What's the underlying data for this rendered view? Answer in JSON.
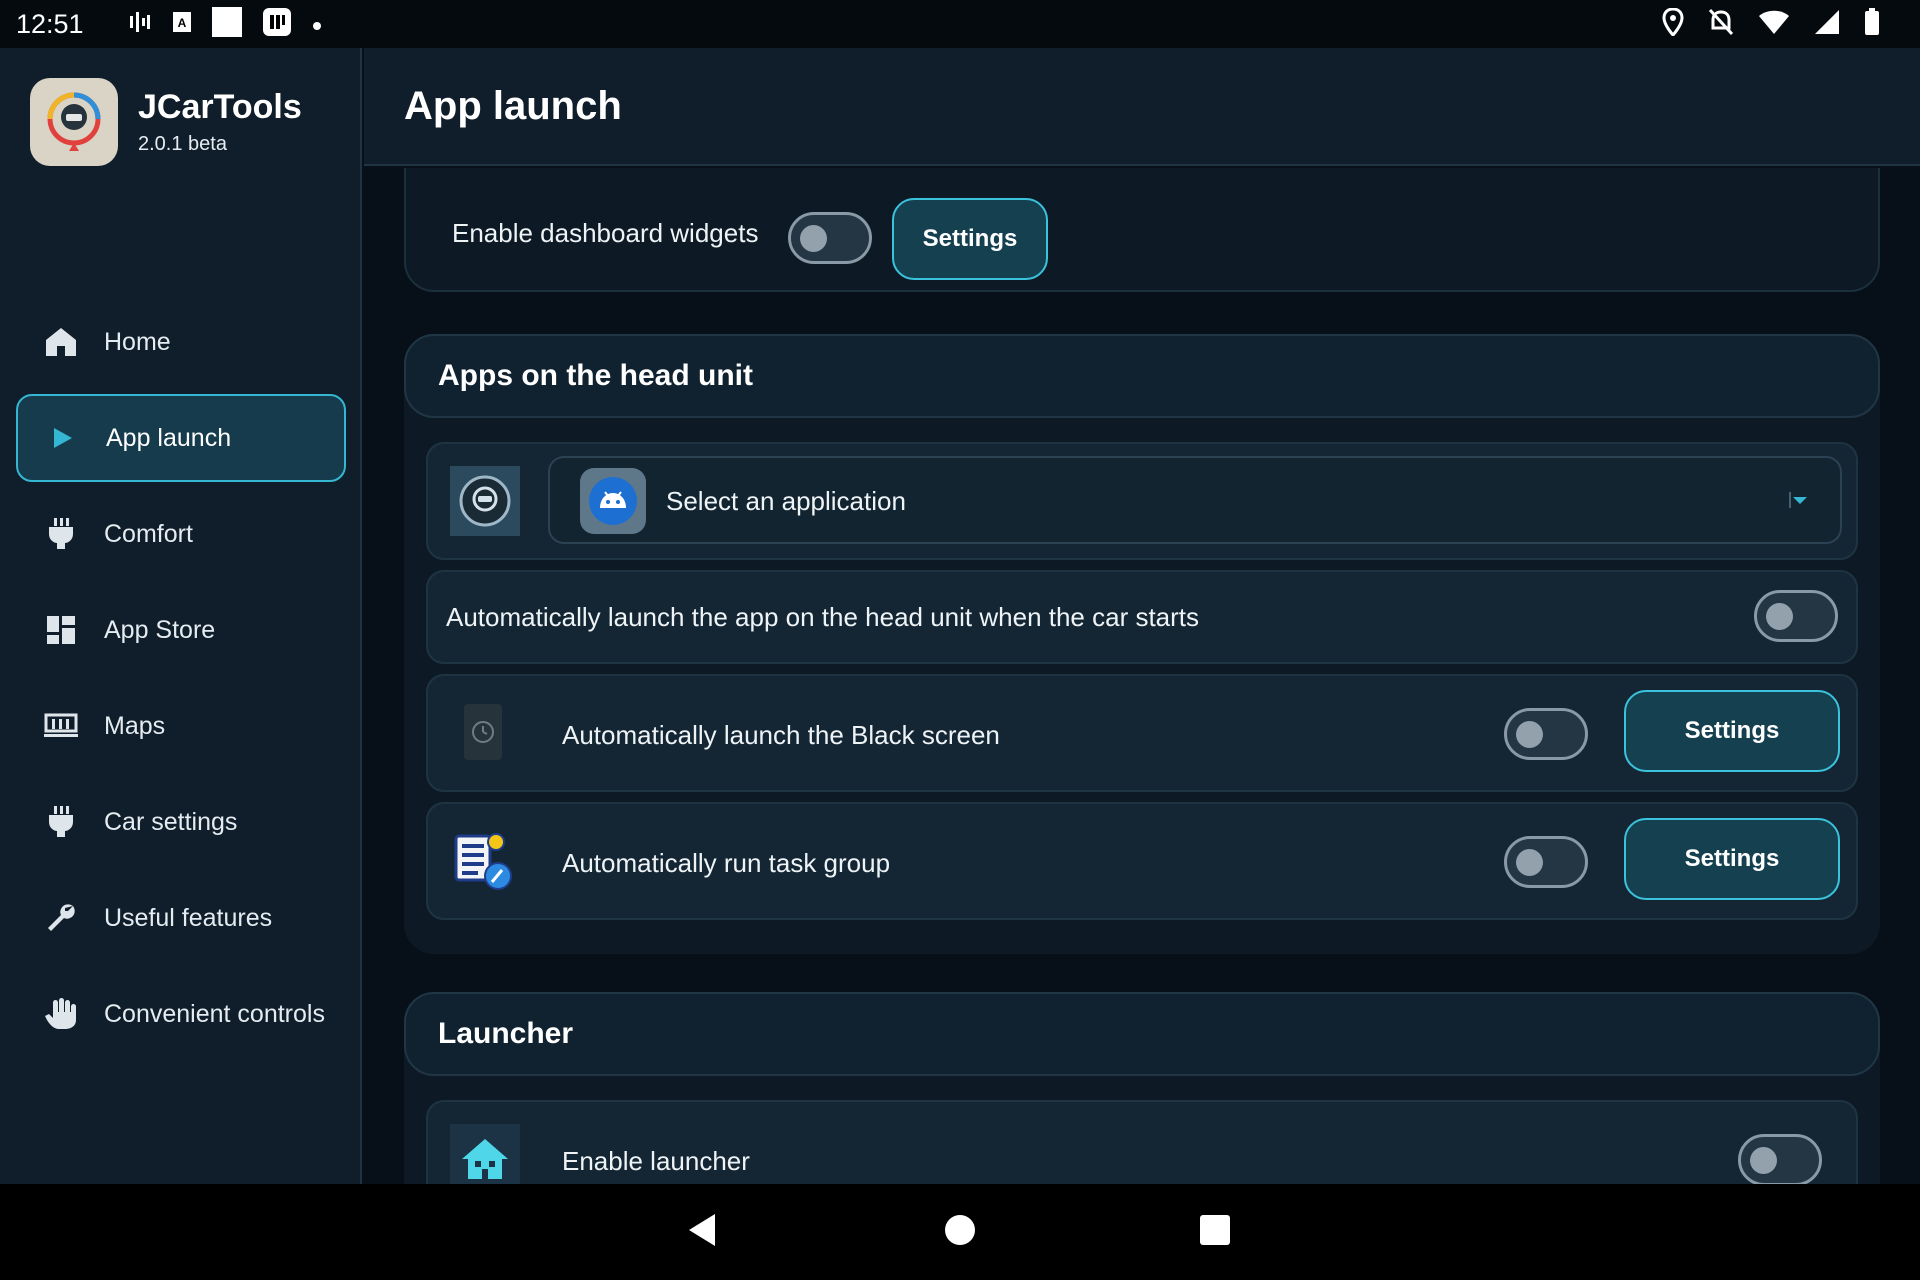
{
  "status": {
    "time": "12:51"
  },
  "app": {
    "name": "JCarTools",
    "version": "2.0.1 beta"
  },
  "nav": {
    "items": [
      {
        "label": "Home",
        "icon": "home-icon"
      },
      {
        "label": "App launch",
        "icon": "play-icon",
        "active": true
      },
      {
        "label": "Comfort",
        "icon": "plug-icon"
      },
      {
        "label": "App Store",
        "icon": "dashboard-icon"
      },
      {
        "label": "Maps",
        "icon": "map-icon"
      },
      {
        "label": "Car settings",
        "icon": "plug-icon"
      },
      {
        "label": "Useful features",
        "icon": "wrench-icon"
      },
      {
        "label": "Convenient controls",
        "icon": "hand-icon"
      }
    ]
  },
  "page": {
    "title": "App launch"
  },
  "widgets": {
    "label": "Enable dashboard widgets",
    "settings": "Settings",
    "enabled": false
  },
  "headunit": {
    "title": "Apps on the head unit",
    "select_placeholder": "Select an application",
    "auto_launch": "Automatically launch the app on the head unit when the car starts",
    "black_screen": "Automatically launch the Black screen",
    "task_group": "Automatically run task group",
    "settings": "Settings"
  },
  "launcher": {
    "title": "Launcher",
    "enable": "Enable launcher"
  },
  "colors": {
    "accent": "#35b6d3",
    "background": "#071018",
    "panel": "#0f1e2a"
  }
}
